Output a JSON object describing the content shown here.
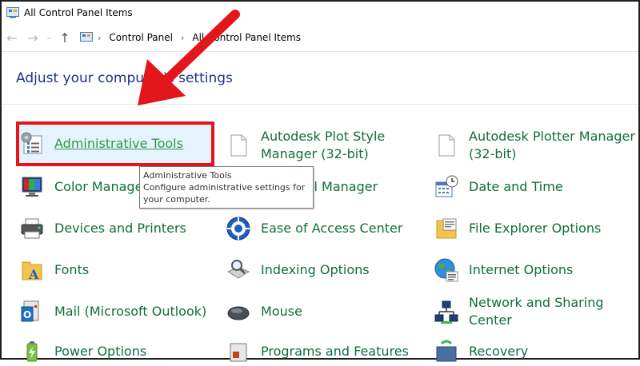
{
  "window": {
    "title": "All Control Panel Items"
  },
  "breadcrumb": [
    "Control Panel",
    "All Control Panel Items"
  ],
  "heading": "Adjust your computer's settings",
  "items": [
    {
      "label": "Administrative Tools",
      "icon": "admin-tools-icon"
    },
    {
      "label": "Autodesk Plot Style Manager (32-bit)",
      "line1": "Autodesk Plot Style",
      "line2": "Manager (32-bit)",
      "icon": "file-icon"
    },
    {
      "label": "Autodesk Plotter Manager (32-bit)",
      "line1": "Autodesk Plotter Manager",
      "line2": "(32-bit)",
      "icon": "file-icon"
    },
    {
      "label": "Color Manage",
      "icon": "color-management-icon"
    },
    {
      "label": "tial Manager",
      "icon": "credential-manager-icon"
    },
    {
      "label": "Date and Time",
      "icon": "calendar-clock-icon"
    },
    {
      "label": "Devices and Printers",
      "icon": "printer-icon"
    },
    {
      "label": "Ease of Access Center",
      "icon": "ease-of-access-icon"
    },
    {
      "label": "File Explorer Options",
      "icon": "folder-options-icon"
    },
    {
      "label": "Fonts",
      "icon": "fonts-folder-icon"
    },
    {
      "label": "Indexing Options",
      "icon": "indexing-icon"
    },
    {
      "label": "Internet Options",
      "icon": "globe-icon"
    },
    {
      "label": "Mail (Microsoft Outlook)",
      "icon": "mail-icon"
    },
    {
      "label": "Mouse",
      "icon": "mouse-icon"
    },
    {
      "label": "Network and Sharing Center",
      "line1": "Network and Sharing",
      "line2": "Center",
      "icon": "network-icon"
    },
    {
      "label": "Power Options",
      "icon": "power-icon"
    },
    {
      "label": "Programs and Features",
      "icon": "programs-icon"
    },
    {
      "label": "Recovery",
      "icon": "recovery-icon"
    }
  ],
  "tooltip": {
    "title": "Administrative Tools",
    "body": "Configure administrative settings for your computer."
  },
  "colors": {
    "link": "#0f6e3c",
    "highlight_border": "#e3161b",
    "heading": "#1e3287"
  }
}
